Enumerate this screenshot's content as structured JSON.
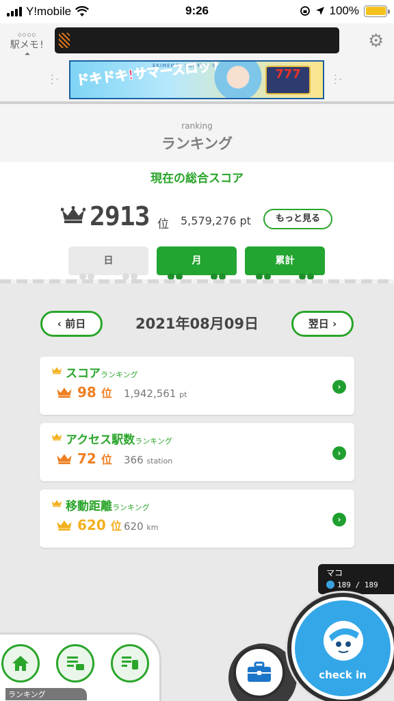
{
  "status_bar": {
    "carrier": "Y!mobile",
    "time": "9:26",
    "battery": "100%"
  },
  "header": {
    "logo_text": "駅メモ!",
    "banner_title": "ドキドキ!サマースロット♪",
    "banner_sub": "EKIMEMO! SUMMER SLOT",
    "banner_slot": "777"
  },
  "ranking_header": {
    "en": "ranking",
    "jp": "ランキング"
  },
  "total": {
    "label": "現在の総合スコア",
    "rank": "2913",
    "rank_unit": "位",
    "points": "5,579,276 pt",
    "more_button": "もっと見る"
  },
  "tabs": [
    {
      "label": "日",
      "active": false
    },
    {
      "label": "月",
      "active": true
    },
    {
      "label": "累計",
      "active": true
    }
  ],
  "date_nav": {
    "prev": "前日",
    "date": "2021年08月09日",
    "next": "翌日"
  },
  "cards": [
    {
      "title": "スコア",
      "suffix": "ランキング",
      "rank": "98",
      "rank_unit": "位",
      "value": "1,942,561",
      "unit": "pt",
      "color": "#ee7f22"
    },
    {
      "title": "アクセス駅数",
      "suffix": "ランキング",
      "rank": "72",
      "rank_unit": "位",
      "value": "366",
      "unit": "station",
      "color": "#ee7f22"
    },
    {
      "title": "移動距離",
      "suffix": "ランキング",
      "rank": "620",
      "rank_unit": "位",
      "value": "620",
      "unit": "km",
      "color": "#f3b01e"
    }
  ],
  "player": {
    "name": "マコ",
    "hp": "189 / 189"
  },
  "bottom": {
    "label": "ランキング",
    "checkin": "check in"
  },
  "colors": {
    "accent": "#2aa52a",
    "rank_orange": "#ee7f22",
    "rank_yellow": "#f3b01e",
    "checkin_blue": "#34a7e8"
  }
}
